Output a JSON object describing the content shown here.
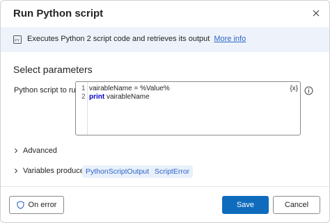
{
  "dialog": {
    "title": "Run Python script",
    "close_icon": "close-icon"
  },
  "info": {
    "icon": "python-file-icon",
    "text": "Executes Python 2 script code and retrieves its output",
    "link": "More info"
  },
  "section": {
    "title": "Select parameters"
  },
  "script_field": {
    "label": "Python script to run:",
    "lines": [
      {
        "num": "1",
        "text": "vairableName = %Value%"
      },
      {
        "num": "2",
        "keyword": "print",
        "text": " vairableName"
      }
    ],
    "variable_button": "{x}",
    "info_icon": "info-icon"
  },
  "advanced": {
    "label": "Advanced"
  },
  "variables_produced": {
    "label": "Variables produced",
    "items": [
      "PythonScriptOutput",
      "ScriptError"
    ]
  },
  "footer": {
    "on_error": "On error",
    "save": "Save",
    "cancel": "Cancel"
  },
  "colors": {
    "accent": "#0f6cbd",
    "link": "#2f63c5",
    "info_bg": "#eef3fb",
    "pill_bg": "#e8f0fb"
  }
}
